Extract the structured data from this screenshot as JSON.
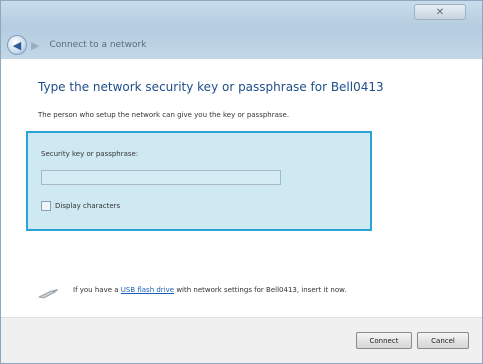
{
  "window": {
    "nav_title": "Connect to a network"
  },
  "main": {
    "heading": "Type the network security key or passphrase for Bell0413",
    "subtext": "The person who setup the network can give you the key or passphrase.",
    "key_label": "Security key or passphrase:",
    "key_value": "",
    "display_characters_label": "Display characters",
    "display_characters_checked": false,
    "usb_prefix": "If you have a ",
    "usb_link": "USB flash drive",
    "usb_suffix": " with network settings for Bell0413, insert it now."
  },
  "footer": {
    "connect_label": "Connect",
    "cancel_label": "Cancel"
  },
  "colors": {
    "heading": "#1f4e8a",
    "highlight_bg": "#cfe9f3",
    "highlight_border": "#2aa3d6"
  }
}
